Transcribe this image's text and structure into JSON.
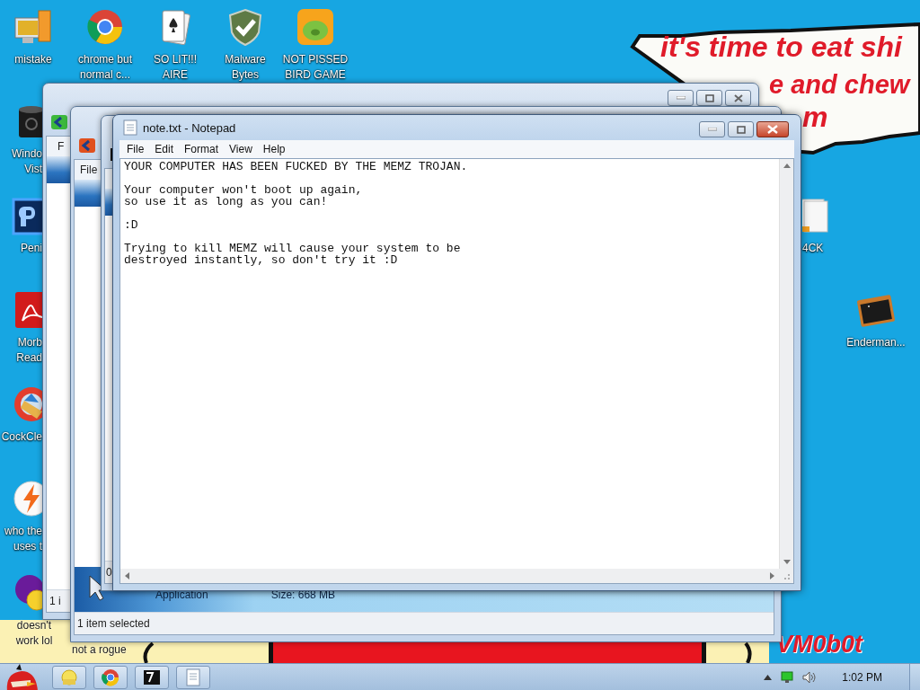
{
  "wallpaper": {
    "bubble_lines": [
      "it's time to eat shi",
      "e and chew",
      "m"
    ],
    "signature": "VM0b0t"
  },
  "desktop_top": [
    {
      "label": [
        "mistake"
      ],
      "kind": "computer"
    },
    {
      "label": [
        "chrome but",
        "normal c..."
      ],
      "kind": "chrome"
    },
    {
      "label": [
        "SO LIT!!!",
        "AIRE"
      ],
      "kind": "cards"
    },
    {
      "label": [
        "Malware",
        "Bytes"
      ],
      "kind": "shield"
    },
    {
      "label": [
        "NOT PISSED",
        "BIRD GAME"
      ],
      "kind": "pig"
    }
  ],
  "desktop_left": [
    {
      "label": [
        "Windo",
        "Vist"
      ],
      "kind": "bin"
    },
    {
      "label": [
        "Peni"
      ],
      "kind": "ps"
    },
    {
      "label": [
        "Morb",
        "Read"
      ],
      "kind": "pdf"
    },
    {
      "label": [
        "CockCle"
      ],
      "kind": "cleaner"
    },
    {
      "label": [
        "who the",
        "uses t"
      ],
      "kind": "bolt"
    },
    {
      "label": [
        "doesn't",
        "work lol"
      ],
      "kind": "yahoo"
    }
  ],
  "desktop_right": [
    {
      "label": [
        "4CK"
      ],
      "kind": "folder"
    },
    {
      "label": [
        "Enderman..."
      ],
      "kind": "terminal"
    }
  ],
  "desktop_bottom_label": "not a rogue",
  "back_windows": [
    {
      "menu_text": "F",
      "status_text": "1 i"
    },
    {
      "menu_text": "File",
      "details": [
        "Application",
        "Size: 668 MB"
      ],
      "status_text": "1 item selected"
    },
    {
      "status_text": "0"
    }
  ],
  "notepad": {
    "title": "note.txt - Notepad",
    "menu": [
      "File",
      "Edit",
      "Format",
      "View",
      "Help"
    ],
    "paragraphs": [
      [
        "YOUR COMPUTER HAS BEEN FUCKED BY THE MEMZ TROJAN."
      ],
      [
        "Your computer won't boot up again,",
        "so use it as long as you can!"
      ],
      [
        ":D"
      ],
      [
        "Trying to kill MEMZ will cause your system to be",
        "destroyed instantly, so don't try it :D"
      ]
    ]
  },
  "taskbar": {
    "buttons": [
      {
        "kind": "explorer"
      },
      {
        "kind": "chrome"
      },
      {
        "kind": "archive"
      },
      {
        "kind": "notepad"
      }
    ],
    "clock": "1:02 PM"
  }
}
